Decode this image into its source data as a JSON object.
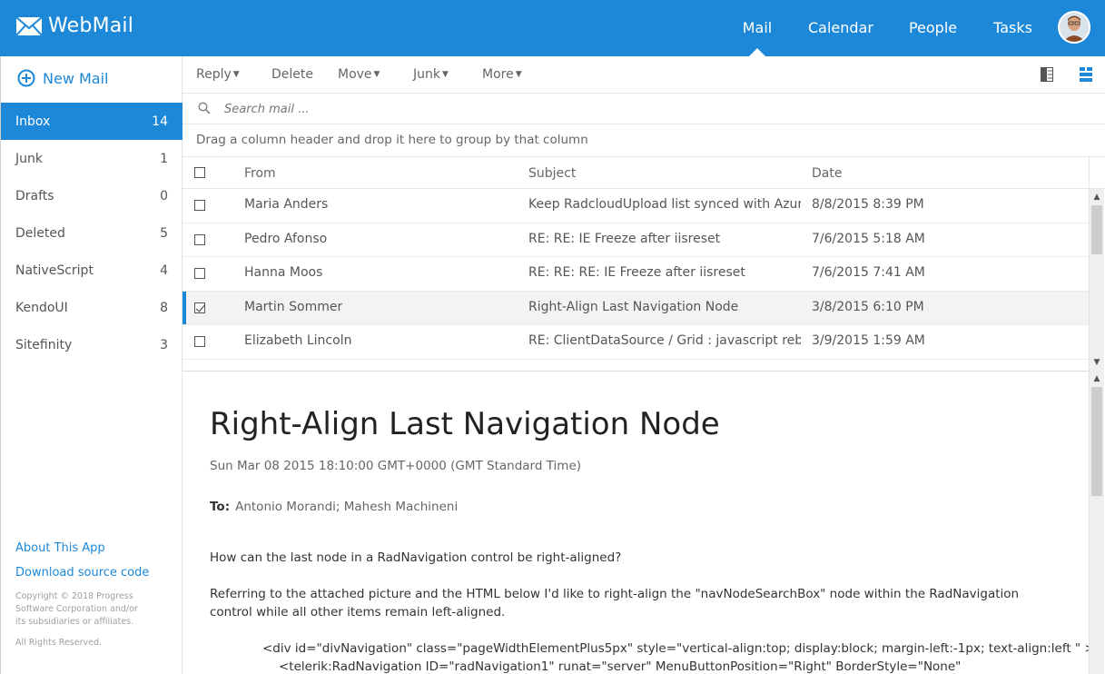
{
  "app": {
    "title": "WebMail"
  },
  "topnav": {
    "items": [
      {
        "label": "Mail",
        "active": true
      },
      {
        "label": "Calendar"
      },
      {
        "label": "People"
      },
      {
        "label": "Tasks"
      }
    ]
  },
  "sidebar": {
    "new_mail_label": "New Mail",
    "folders": [
      {
        "label": "Inbox",
        "count": "14",
        "active": true
      },
      {
        "label": "Junk",
        "count": "1"
      },
      {
        "label": "Drafts",
        "count": "0"
      },
      {
        "label": "Deleted",
        "count": "5"
      },
      {
        "label": "NativeScript",
        "count": "4"
      },
      {
        "label": "KendoUI",
        "count": "8"
      },
      {
        "label": "Sitefinity",
        "count": "3"
      }
    ],
    "about_link": "About This App",
    "download_link": "Download source code",
    "copyright": "Copyright © 2018 Progress Software Corporation and/or its subsidiaries or affiliates.",
    "reserved": "All Rights Reserved."
  },
  "toolbar": {
    "reply": "Reply",
    "delete": "Delete",
    "move": "Move",
    "junk": "Junk",
    "more": "More"
  },
  "search": {
    "placeholder": "Search mail ..."
  },
  "grid": {
    "group_hint": "Drag a column header and drop it here to group by that column",
    "columns": {
      "from": "From",
      "subject": "Subject",
      "date": "Date"
    },
    "rows": [
      {
        "from": "Maria Anders",
        "subject": "Keep RadcloudUpload list synced with Azur...",
        "date": "8/8/2015 8:39 PM",
        "checked": false
      },
      {
        "from": "Pedro Afonso",
        "subject": "RE: RE: IE Freeze after iisreset",
        "date": "7/6/2015 5:18 AM",
        "checked": false
      },
      {
        "from": "Hanna Moos",
        "subject": "RE: RE: RE: IE Freeze after iisreset",
        "date": "7/6/2015 7:41 AM",
        "checked": false
      },
      {
        "from": "Martin Sommer",
        "subject": "Right-Align Last Navigation Node",
        "date": "3/8/2015 6:10 PM",
        "checked": true
      },
      {
        "from": "Elizabeth Lincoln",
        "subject": "RE: ClientDataSource / Grid : javascript rebi...",
        "date": "3/9/2015 1:59 AM",
        "checked": false
      }
    ]
  },
  "message": {
    "title": "Right-Align Last Navigation Node",
    "date": "Sun Mar 08 2015 18:10:00 GMT+0000 (GMT Standard Time)",
    "to_label": "To:",
    "to": "Antonio Morandi; Mahesh Machineni",
    "body_p1": "How can the last node in a RadNavigation control be right-aligned?",
    "body_p2": "Referring to the attached picture and the HTML below I'd like to right-align the \"navNodeSearchBox\" node within the RadNavigation control while all other items remain left-aligned.",
    "code1": "<div id=\"divNavigation\" class=\"pageWidthElementPlus5px\" style=\"vertical-align:top; display:block; margin-left:-1px; text-align:left \" >",
    "code2": "<telerik:RadNavigation ID=\"radNavigation1\" runat=\"server\" MenuButtonPosition=\"Right\" BorderStyle=\"None\""
  },
  "colors": {
    "accent": "#1e88d8"
  }
}
